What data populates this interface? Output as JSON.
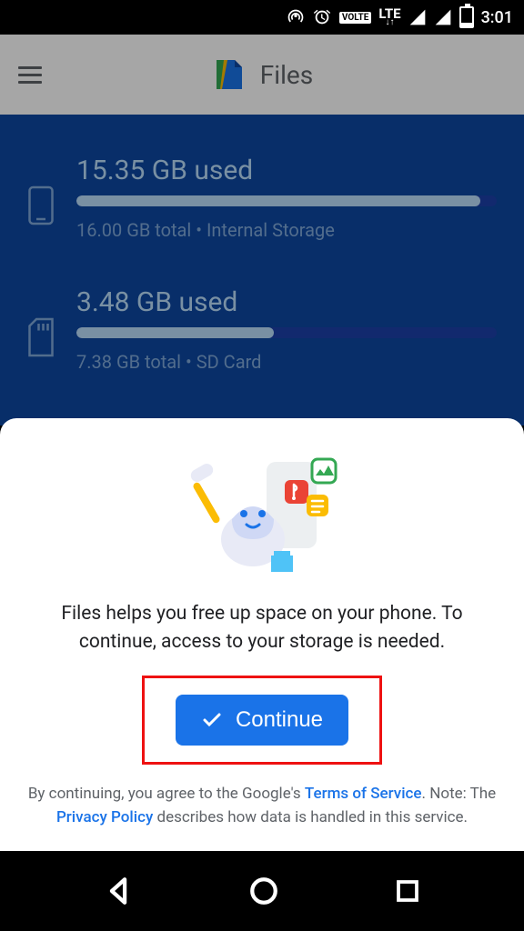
{
  "statusbar": {
    "time": "3:01",
    "lte_label": "LTE",
    "volte_label": "VOLTE"
  },
  "header": {
    "app_name": "Files"
  },
  "storage": {
    "internal": {
      "used": "15.35 GB used",
      "total": "16.00 GB total • Internal Storage",
      "percent": 96
    },
    "sdcard": {
      "used": "3.48 GB used",
      "total": "7.38 GB total • SD Card",
      "percent": 47
    }
  },
  "modal": {
    "message": "Files helps you free up space on your phone. To continue, access to your storage is needed.",
    "continue_label": "Continue",
    "legal_pre": "By continuing, you agree to the Google's ",
    "tos": "Terms of Service",
    "legal_mid": ". Note: The ",
    "privacy": "Privacy Policy",
    "legal_post": " describes how data is handled in this service."
  }
}
